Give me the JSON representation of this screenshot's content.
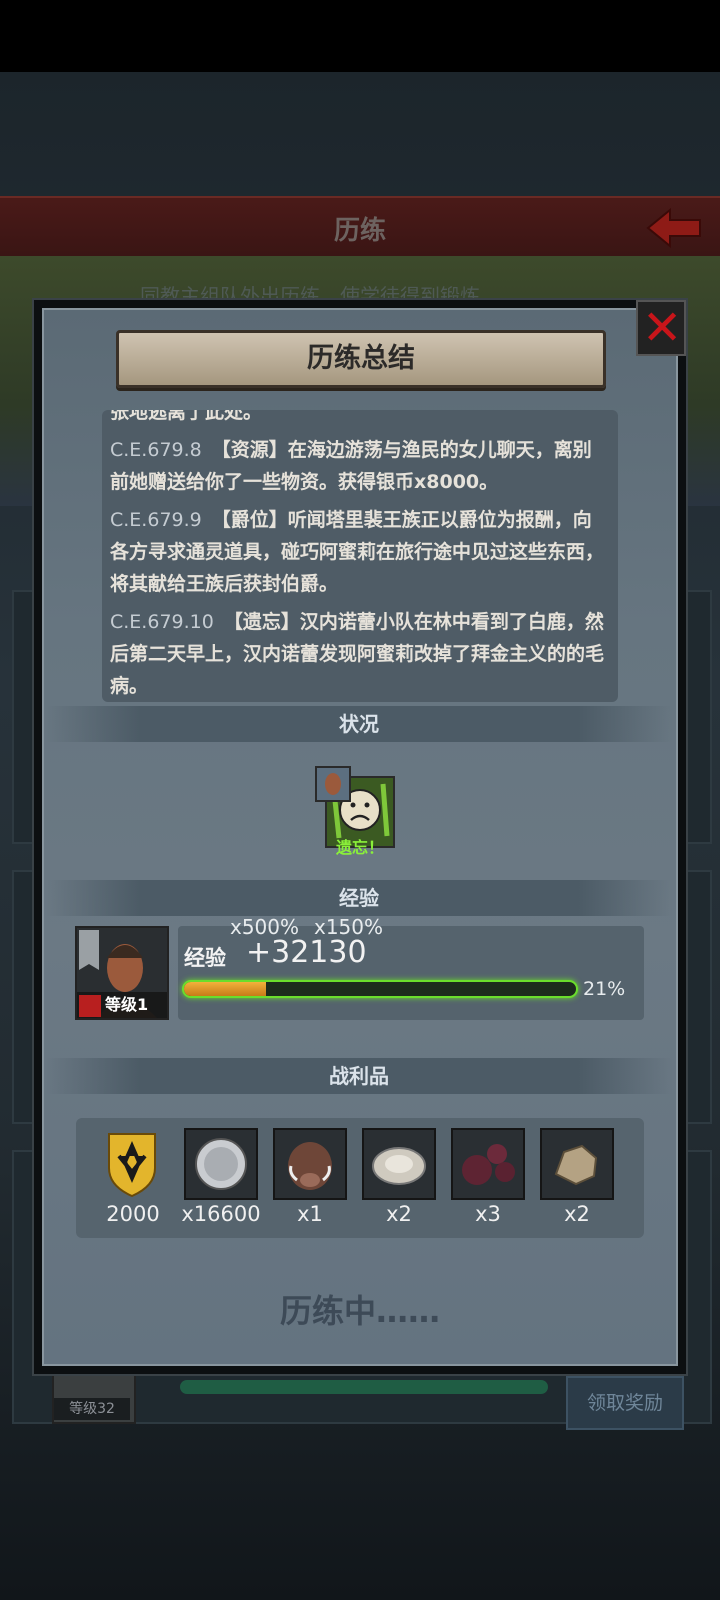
{
  "background": {
    "title": "历练",
    "subtitle": "同教主组队外出历练，使学徒得到锻炼",
    "level_badge": "等级32",
    "claim_button": "领取奖励"
  },
  "dialog": {
    "title": "历练总结",
    "log": [
      {
        "date": "",
        "text": "张地逃离了此处。"
      },
      {
        "date": "C.E.679.8",
        "text": "【资源】在海边游荡与渔民的女儿聊天，离别前她赠送给你了一些物资。获得银币x8000。"
      },
      {
        "date": "C.E.679.9",
        "text": "【爵位】听闻塔里裴王族正以爵位为报酬，向各方寻求通灵道具，碰巧阿蜜莉在旅行途中见过这些东西，将其献给王族后获封伯爵。"
      },
      {
        "date": "C.E.679.10",
        "text": "【遗忘】汉内诺蕾小队在林中看到了白鹿，然后第二天早上，汉内诺蕾发现阿蜜莉改掉了拜金主义的的毛病。"
      }
    ],
    "status_section": {
      "title": "状况",
      "status_label": "遗忘！"
    },
    "exp_section": {
      "title": "经验",
      "multiplier_1": "x500%",
      "multiplier_2": "x150%",
      "label": "经验",
      "value": "+32130",
      "progress": 0.21,
      "progress_text": "21%",
      "level_badge": "等级1"
    },
    "loot_section": {
      "title": "战利品",
      "items": [
        {
          "icon": "gold-crest-icon",
          "count": "2000"
        },
        {
          "icon": "silver-coin-icon",
          "count": "x16600"
        },
        {
          "icon": "boar-head-icon",
          "count": "x1"
        },
        {
          "icon": "oyster-icon",
          "count": "x2"
        },
        {
          "icon": "berries-icon",
          "count": "x3"
        },
        {
          "icon": "ore-rock-icon",
          "count": "x2"
        }
      ]
    },
    "footer_status": "历练中……"
  },
  "colors": {
    "accent_green": "#6ade2c",
    "close_red": "#c8151a",
    "banner": "#b6a993"
  }
}
